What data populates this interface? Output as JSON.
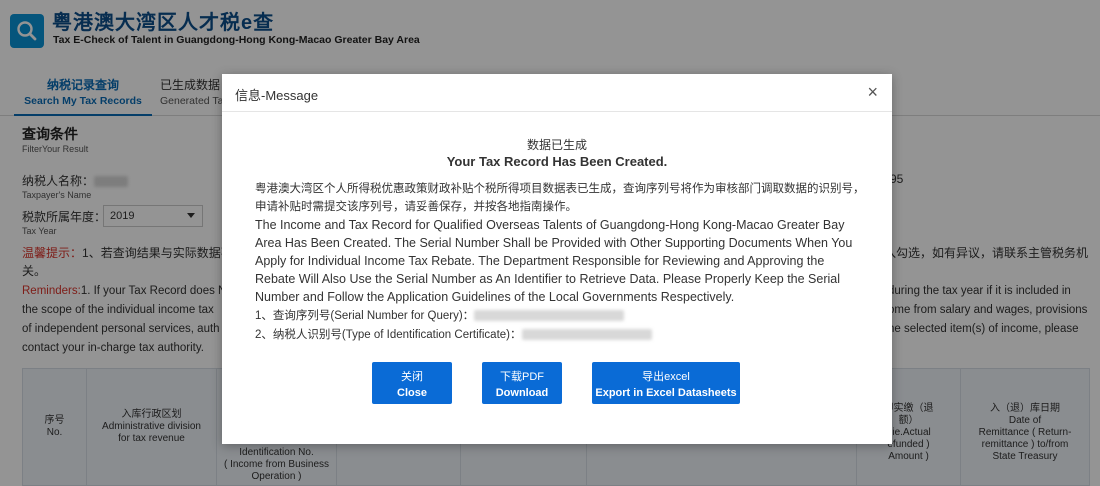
{
  "header": {
    "title_cn": "粤港澳大湾区人才税e查",
    "title_en": "Tax E-Check of Talent in Guangdong-Hong Kong-Macao Greater Bay Area",
    "logo_icon": "search-icon"
  },
  "tabs": [
    {
      "cn": "纳税记录查询",
      "en": "Search My Tax Records",
      "active": true
    },
    {
      "cn": "已生成数据",
      "en": "Generated Ta",
      "active": false
    }
  ],
  "filter": {
    "title_cn": "查询条件",
    "title_en": "FilterYour Result",
    "taxpayer_label_cn": "纳税人名称：",
    "taxpayer_label_en": "Taxpayer's Name",
    "year_label_cn": "税款所属年度：",
    "year_label_en": "Tax Year",
    "year_value": "2019",
    "side_number": "95"
  },
  "reminders": {
    "cn_label": "温馨提示：",
    "cn_text": "1、若查询结果与实际数据不",
    "cn_right": "入勾选，如有异议，请联系主管税务机",
    "cn_line2": "关。",
    "en_label": "Reminders:",
    "en_line1": "1. If your Tax Record does N",
    "en_line1_right": "during the tax year if it is included in",
    "en_line2": "the scope of the individual income tax",
    "en_line2_right": "ome from salary and wages, provisions",
    "en_line3": "of independent personal services, auth",
    "en_line3_right": "he selected item(s) of income, please",
    "en_line4": "contact your in-charge tax authority."
  },
  "table": {
    "col_no_cn": "序号",
    "col_no_en": "No.",
    "col_admin_cn": "入库行政区划",
    "col_admin_en1": "Administrative division",
    "col_admin_en2": "for tax revenue",
    "col_id_1": "Identification No.",
    "col_id_2": "( Income from Business",
    "col_id_3": "Operation )",
    "col_amount_1": "即实缴（退",
    "col_amount_2": "额）",
    "col_amount_3": "( ie.Actual",
    "col_amount_4": "efunded )",
    "col_amount_5": "Amount )",
    "col_date_cn": "入（退）库日期",
    "col_date_1": "Date of",
    "col_date_2": "Remittance ( Return-",
    "col_date_3": "remittance ) to/from",
    "col_date_4": "State Treasury"
  },
  "modal": {
    "title": "信息-Message",
    "close_symbol": "×",
    "heading_cn": "数据已生成",
    "heading_en": "Your Tax Record Has Been Created.",
    "body_cn": "粤港澳大湾区个人所得税优惠政策财政补贴个税所得项目数据表已生成，查询序列号将作为审核部门调取数据的识别号，申请补贴时需提交该序列号，请妥善保存，并按各地指南操作。",
    "body_en": "The Income and Tax Record for Qualified Overseas Talents of Guangdong-Hong Kong-Macao Greater Bay Area Has Been Created. The Serial Number Shall be Provided with Other Supporting Documents When You Apply for Individual Income Tax Rebate. The Department Responsible for Reviewing and Approving the Rebate Will Also Use the Serial Number as An Identifier to Retrieve Data. Please Properly Keep the Serial Number and Follow the Application Guidelines of the Local Governments Respectively.",
    "serial_label": "1、查询序列号(Serial Number for Query)：",
    "id_label": "2、纳税人识别号(Type of Identification Certificate)：",
    "buttons": {
      "close_cn": "关闭",
      "close_en": "Close",
      "download_cn": "下载PDF",
      "download_en": "Download",
      "export_cn": "导出excel",
      "export_en": "Export in Excel Datasheets"
    }
  }
}
